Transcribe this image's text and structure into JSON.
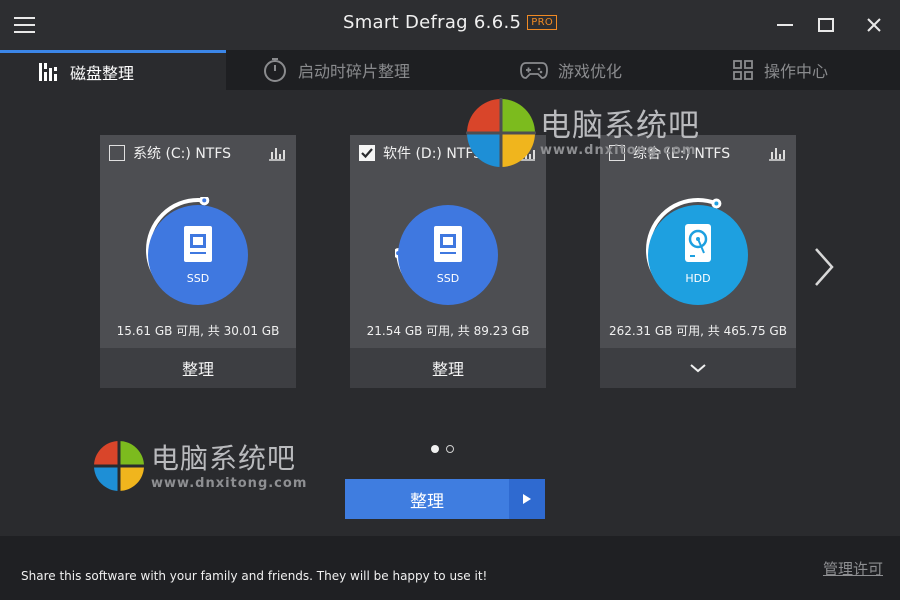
{
  "app": {
    "title": "Smart Defrag 6.6.5",
    "badge": "PRO",
    "accent_color": "#3b86e8",
    "badge_color": "#f08a24"
  },
  "tabs": [
    {
      "label": "磁盘整理",
      "icon": "disk-defrag-icon",
      "active": true
    },
    {
      "label": "启动时碎片整理",
      "icon": "timer-icon",
      "active": false
    },
    {
      "label": "游戏优化",
      "icon": "gamepad-icon",
      "active": false
    },
    {
      "label": "操作中心",
      "icon": "grid-icon",
      "active": false
    }
  ],
  "drives": [
    {
      "name": "系统 (C:) NTFS",
      "checked": false,
      "type": "SSD",
      "icon": "ssd-chip-icon",
      "capacity": "15.61 GB 可用, 共 30.01 GB",
      "free_fraction": 0.52,
      "action": "整理",
      "circle_color": "#3f78e0"
    },
    {
      "name": "软件 (D:) NTFS",
      "checked": true,
      "type": "SSD",
      "icon": "ssd-chip-icon",
      "capacity": "21.54 GB 可用, 共 89.23 GB",
      "free_fraction": 0.24,
      "action": "整理",
      "circle_color": "#3f78e0"
    },
    {
      "name": "综合 (E:) NTFS",
      "checked": false,
      "type": "HDD",
      "icon": "hdd-icon",
      "capacity": "262.31 GB 可用, 共 465.75 GB",
      "free_fraction": 0.56,
      "action": "",
      "action_icon": "chevron-down-icon",
      "circle_color": "#1ea0e0"
    }
  ],
  "pagination": {
    "pages": 2,
    "current": 1
  },
  "main_button": {
    "label": "整理",
    "arrow_icon": "play-arrow-icon"
  },
  "watermark": {
    "title": "电脑系统吧",
    "url": "www.dnxitong.com"
  },
  "footer": {
    "share_text": "Share this software with your family and friends. They will be happy to use it!",
    "license_link": "管理许可"
  }
}
